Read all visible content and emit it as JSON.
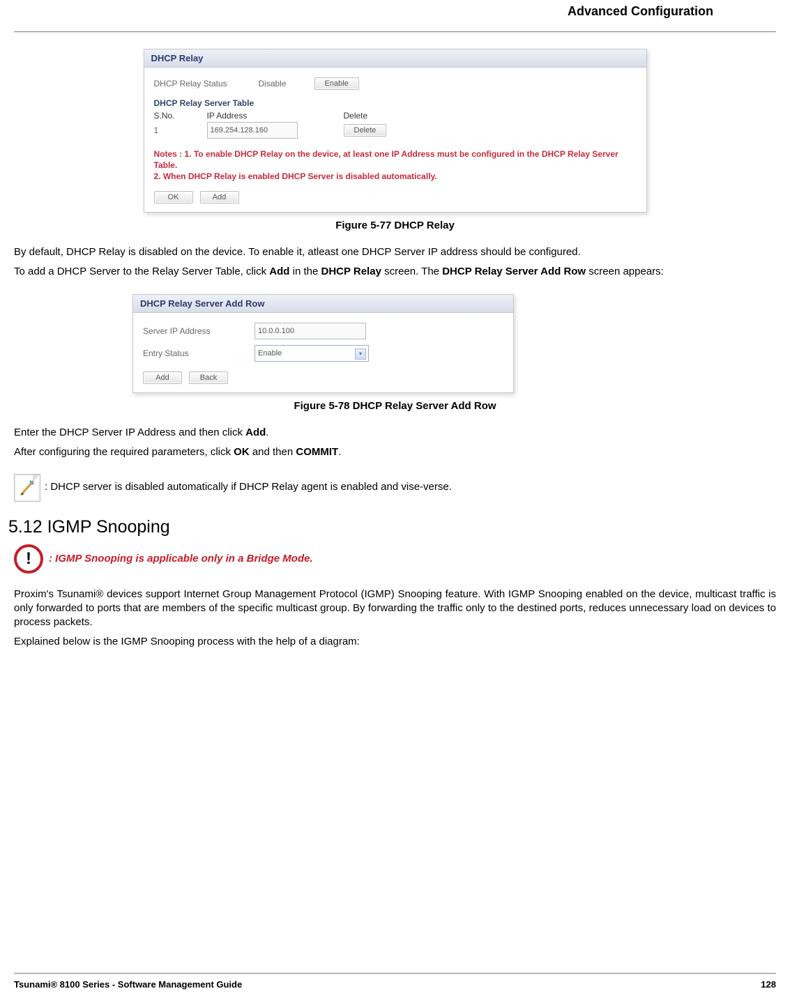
{
  "header": {
    "chapter": "Advanced Configuration"
  },
  "fig77": {
    "panel_title": "DHCP Relay",
    "status_label": "DHCP Relay Status",
    "status_value": "Disable",
    "enable_btn": "Enable",
    "table_heading": "DHCP Relay Server Table",
    "th_sno": "S.No.",
    "th_ip": "IP Address",
    "th_delete": "Delete",
    "row1_sno": "1",
    "row1_ip": "169.254.128.160",
    "delete_btn": "Delete",
    "notes": "Notes : 1. To enable DHCP Relay on the device, at least one IP Address must be configured in the DHCP Relay Server Table.\n             2. When DHCP Relay is enabled DHCP Server is disabled automatically.",
    "ok_btn": "OK",
    "add_btn": "Add",
    "caption": "Figure 5-77 DHCP Relay"
  },
  "para1": "By default, DHCP Relay is disabled on the device. To enable it, atleast one DHCP Server IP address should be configured.",
  "para2_pre": "To add a DHCP Server to the Relay Server Table, click ",
  "para2_b1": "Add",
  "para2_mid": " in the ",
  "para2_b2": "DHCP Relay",
  "para2_mid2": " screen. The ",
  "para2_b3": "DHCP Relay Server Add Row",
  "para2_post": " screen appears:",
  "fig78": {
    "panel_title": "DHCP Relay Server Add Row",
    "ip_label": "Server IP Address",
    "ip_value": "10.0.0.100",
    "status_label": "Entry Status",
    "status_value": "Enable",
    "add_btn": "Add",
    "back_btn": "Back",
    "caption": "Figure 5-78 DHCP Relay Server Add Row"
  },
  "para3_pre": "Enter the DHCP Server IP Address and then click ",
  "para3_b1": "Add",
  "para3_post": ".",
  "para4_pre": "After configuring the required parameters, click ",
  "para4_b1": "OK",
  "para4_mid": " and then ",
  "para4_b2": "COMMIT",
  "para4_post": ".",
  "note1": ": DHCP server is disabled automatically if DHCP Relay agent is enabled and vise-verse.",
  "section_heading": "5.12 IGMP Snooping",
  "warn1": ": IGMP Snooping is applicable only in a Bridge Mode.",
  "para5": "Proxim's Tsunami® devices support Internet Group Management Protocol (IGMP) Snooping feature. With IGMP Snooping enabled on the device, multicast traffic is only forwarded to ports that are members of the specific multicast group. By forwarding the traffic only to the destined ports, reduces unnecessary load on devices to process packets.",
  "para6": "Explained below is the IGMP Snooping process with the help of a diagram:",
  "footer": {
    "left": "Tsunami® 8100 Series - Software Management Guide",
    "right": "128"
  }
}
